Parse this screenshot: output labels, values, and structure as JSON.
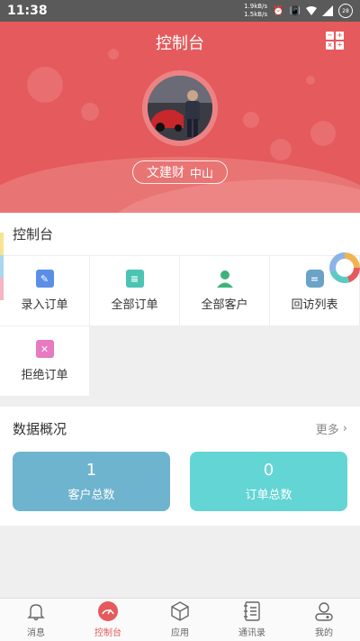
{
  "status": {
    "time": "11:38",
    "speed_up": "1.9kB/s",
    "speed_down": "1.5kB/s",
    "battery": "28"
  },
  "header": {
    "title": "控制台",
    "user_name": "文建财",
    "user_city": "中山",
    "calc_keys": [
      "−",
      "+",
      "×",
      "÷"
    ]
  },
  "dashboard": {
    "title": "控制台",
    "items": [
      {
        "label": "录入订单",
        "icon": "edit-order-icon",
        "color": "#5b8ee6"
      },
      {
        "label": "全部订单",
        "icon": "clipboard-list-icon",
        "color": "#4cc4b4"
      },
      {
        "label": "全部客户",
        "icon": "customer-icon",
        "color": "#3db37a"
      },
      {
        "label": "回访列表",
        "icon": "chat-bubble-icon",
        "color": "#6aa2c8"
      },
      {
        "label": "拒绝订单",
        "icon": "reject-order-icon",
        "color": "#e87ac0"
      }
    ]
  },
  "overview": {
    "title": "数据概况",
    "more": "更多",
    "cards": [
      {
        "value": "1",
        "label": "客户总数",
        "color": "#6fb4cf"
      },
      {
        "value": "0",
        "label": "订单总数",
        "color": "#63d5d4"
      }
    ]
  },
  "nav": {
    "tabs": [
      {
        "label": "消息",
        "icon": "bell-icon"
      },
      {
        "label": "控制台",
        "icon": "dashboard-gauge-icon"
      },
      {
        "label": "应用",
        "icon": "cube-icon"
      },
      {
        "label": "通讯录",
        "icon": "address-book-icon"
      },
      {
        "label": "我的",
        "icon": "user-icon"
      }
    ],
    "active": "控制台"
  },
  "colors": {
    "brand": "#e55a5c"
  }
}
